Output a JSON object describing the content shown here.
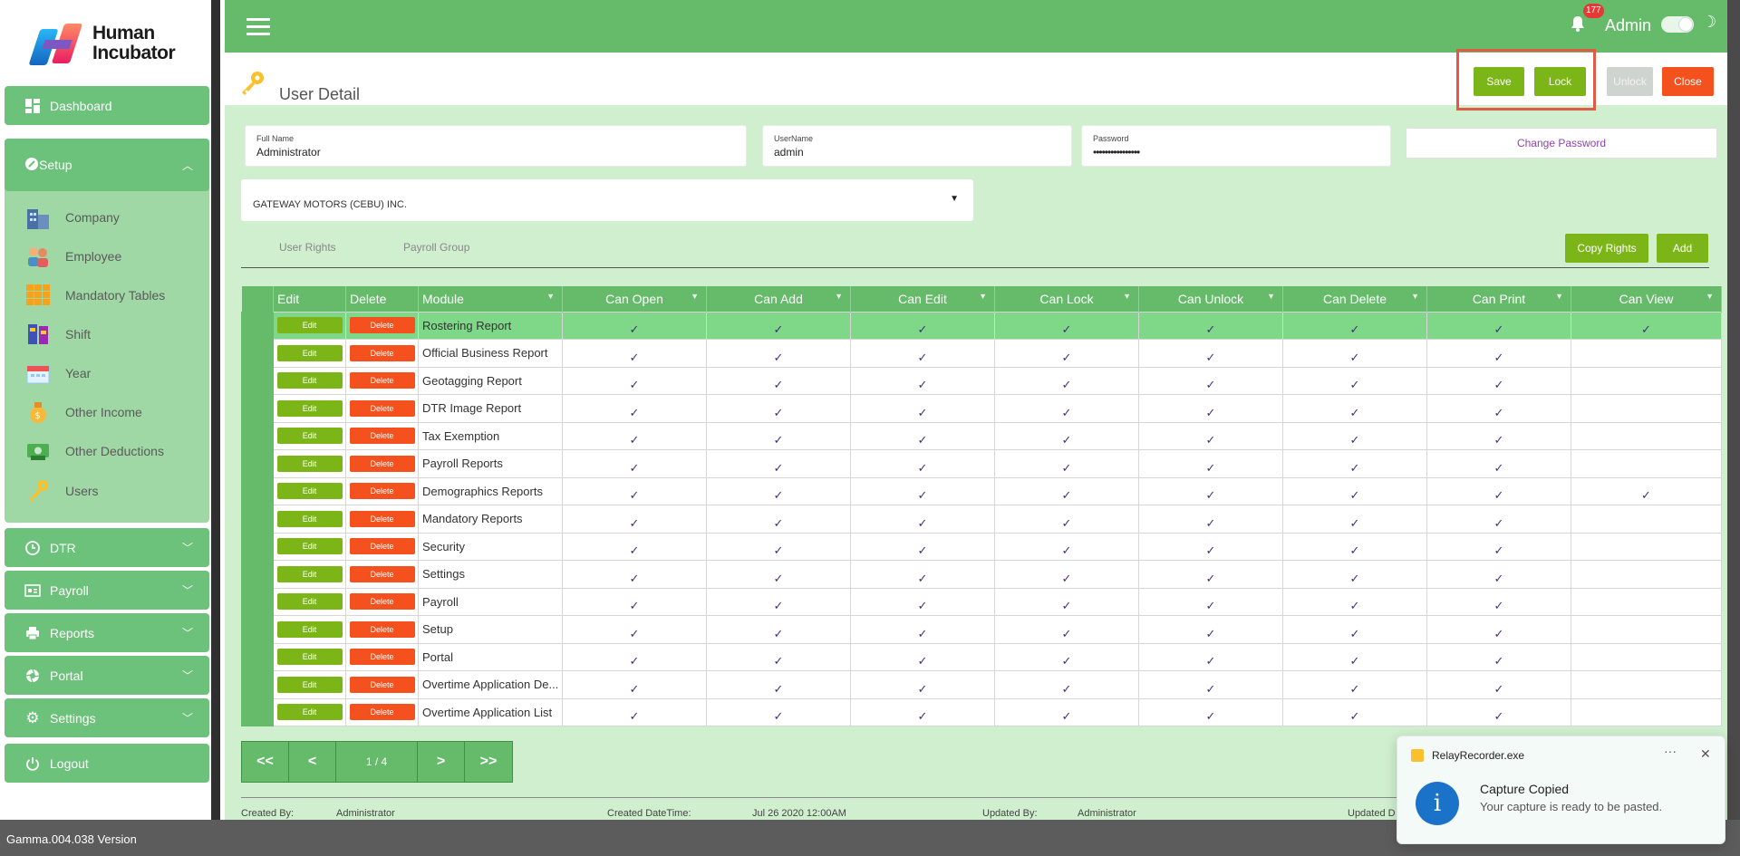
{
  "app": {
    "name_line1": "Human",
    "name_line2": "Incubator",
    "version": "Gamma.004.038 Version"
  },
  "sidebar": {
    "dashboard": "Dashboard",
    "setup": "Setup",
    "setup_items": [
      "Company",
      "Employee",
      "Mandatory Tables",
      "Shift",
      "Year",
      "Other Income",
      "Other Deductions",
      "Users"
    ],
    "sections": [
      "DTR",
      "Payroll",
      "Reports",
      "Portal",
      "Settings"
    ],
    "logout": "Logout"
  },
  "topbar": {
    "notifications": "177",
    "user": "Admin"
  },
  "page": {
    "title": "User Detail"
  },
  "actions": {
    "save": "Save",
    "lock": "Lock",
    "unlock": "Unlock",
    "close": "Close"
  },
  "form": {
    "full_name_label": "Full Name",
    "full_name": "Administrator",
    "username_label": "UserName",
    "username": "admin",
    "password_label": "Password",
    "password": "••••••••••••••••",
    "change_password": "Change Password",
    "company": "GATEWAY MOTORS (CEBU) INC."
  },
  "tabs": {
    "user_rights": "User Rights",
    "payroll_group": "Payroll Group",
    "copy_rights": "Copy Rights",
    "add": "Add"
  },
  "grid": {
    "columns": [
      "Edit",
      "Delete",
      "Module",
      "Can Open",
      "Can Add",
      "Can Edit",
      "Can Lock",
      "Can Unlock",
      "Can Delete",
      "Can Print",
      "Can View"
    ],
    "edit_label": "Edit",
    "delete_label": "Delete",
    "check": "✓",
    "rows": [
      {
        "module": "Rostering Report",
        "perms": [
          1,
          1,
          1,
          1,
          1,
          1,
          1,
          1
        ]
      },
      {
        "module": "Official Business Report",
        "perms": [
          1,
          1,
          1,
          1,
          1,
          1,
          1,
          0
        ]
      },
      {
        "module": "Geotagging Report",
        "perms": [
          1,
          1,
          1,
          1,
          1,
          1,
          1,
          0
        ]
      },
      {
        "module": "DTR Image Report",
        "perms": [
          1,
          1,
          1,
          1,
          1,
          1,
          1,
          0
        ]
      },
      {
        "module": "Tax Exemption",
        "perms": [
          1,
          1,
          1,
          1,
          1,
          1,
          1,
          0
        ]
      },
      {
        "module": "Payroll Reports",
        "perms": [
          1,
          1,
          1,
          1,
          1,
          1,
          1,
          0
        ]
      },
      {
        "module": "Demographics Reports",
        "perms": [
          1,
          1,
          1,
          1,
          1,
          1,
          1,
          1
        ]
      },
      {
        "module": "Mandatory Reports",
        "perms": [
          1,
          1,
          1,
          1,
          1,
          1,
          1,
          0
        ]
      },
      {
        "module": "Security",
        "perms": [
          1,
          1,
          1,
          1,
          1,
          1,
          1,
          0
        ]
      },
      {
        "module": "Settings",
        "perms": [
          1,
          1,
          1,
          1,
          1,
          1,
          1,
          0
        ]
      },
      {
        "module": "Payroll",
        "perms": [
          1,
          1,
          1,
          1,
          1,
          1,
          1,
          0
        ]
      },
      {
        "module": "Setup",
        "perms": [
          1,
          1,
          1,
          1,
          1,
          1,
          1,
          0
        ]
      },
      {
        "module": "Portal",
        "perms": [
          1,
          1,
          1,
          1,
          1,
          1,
          1,
          0
        ]
      },
      {
        "module": "Overtime Application De...",
        "perms": [
          1,
          1,
          1,
          1,
          1,
          1,
          1,
          0
        ]
      },
      {
        "module": "Overtime Application List",
        "perms": [
          1,
          1,
          1,
          1,
          1,
          1,
          1,
          0
        ]
      }
    ]
  },
  "pager": {
    "first": "<<",
    "prev": "<",
    "info": "1 / 4",
    "next": ">",
    "last": ">>"
  },
  "footer": {
    "created_by_label": "Created By:",
    "created_by": "Administrator",
    "created_dt_label": "Created DateTime:",
    "created_dt": "Jul 26 2020 12:00AM",
    "updated_by_label": "Updated By:",
    "updated_by": "Administrator",
    "updated_dt_label": "Updated D"
  },
  "toast": {
    "app": "RelayRecorder.exe",
    "title": "Capture Copied",
    "message": "Your capture is ready to be pasted.",
    "more": "···",
    "close": "✕"
  },
  "colors": {
    "primary": "#66bb6a",
    "button_green": "#7cb518",
    "danger": "#f4511e",
    "content_bg": "#d0efcf",
    "highlight": "#e05a47"
  }
}
